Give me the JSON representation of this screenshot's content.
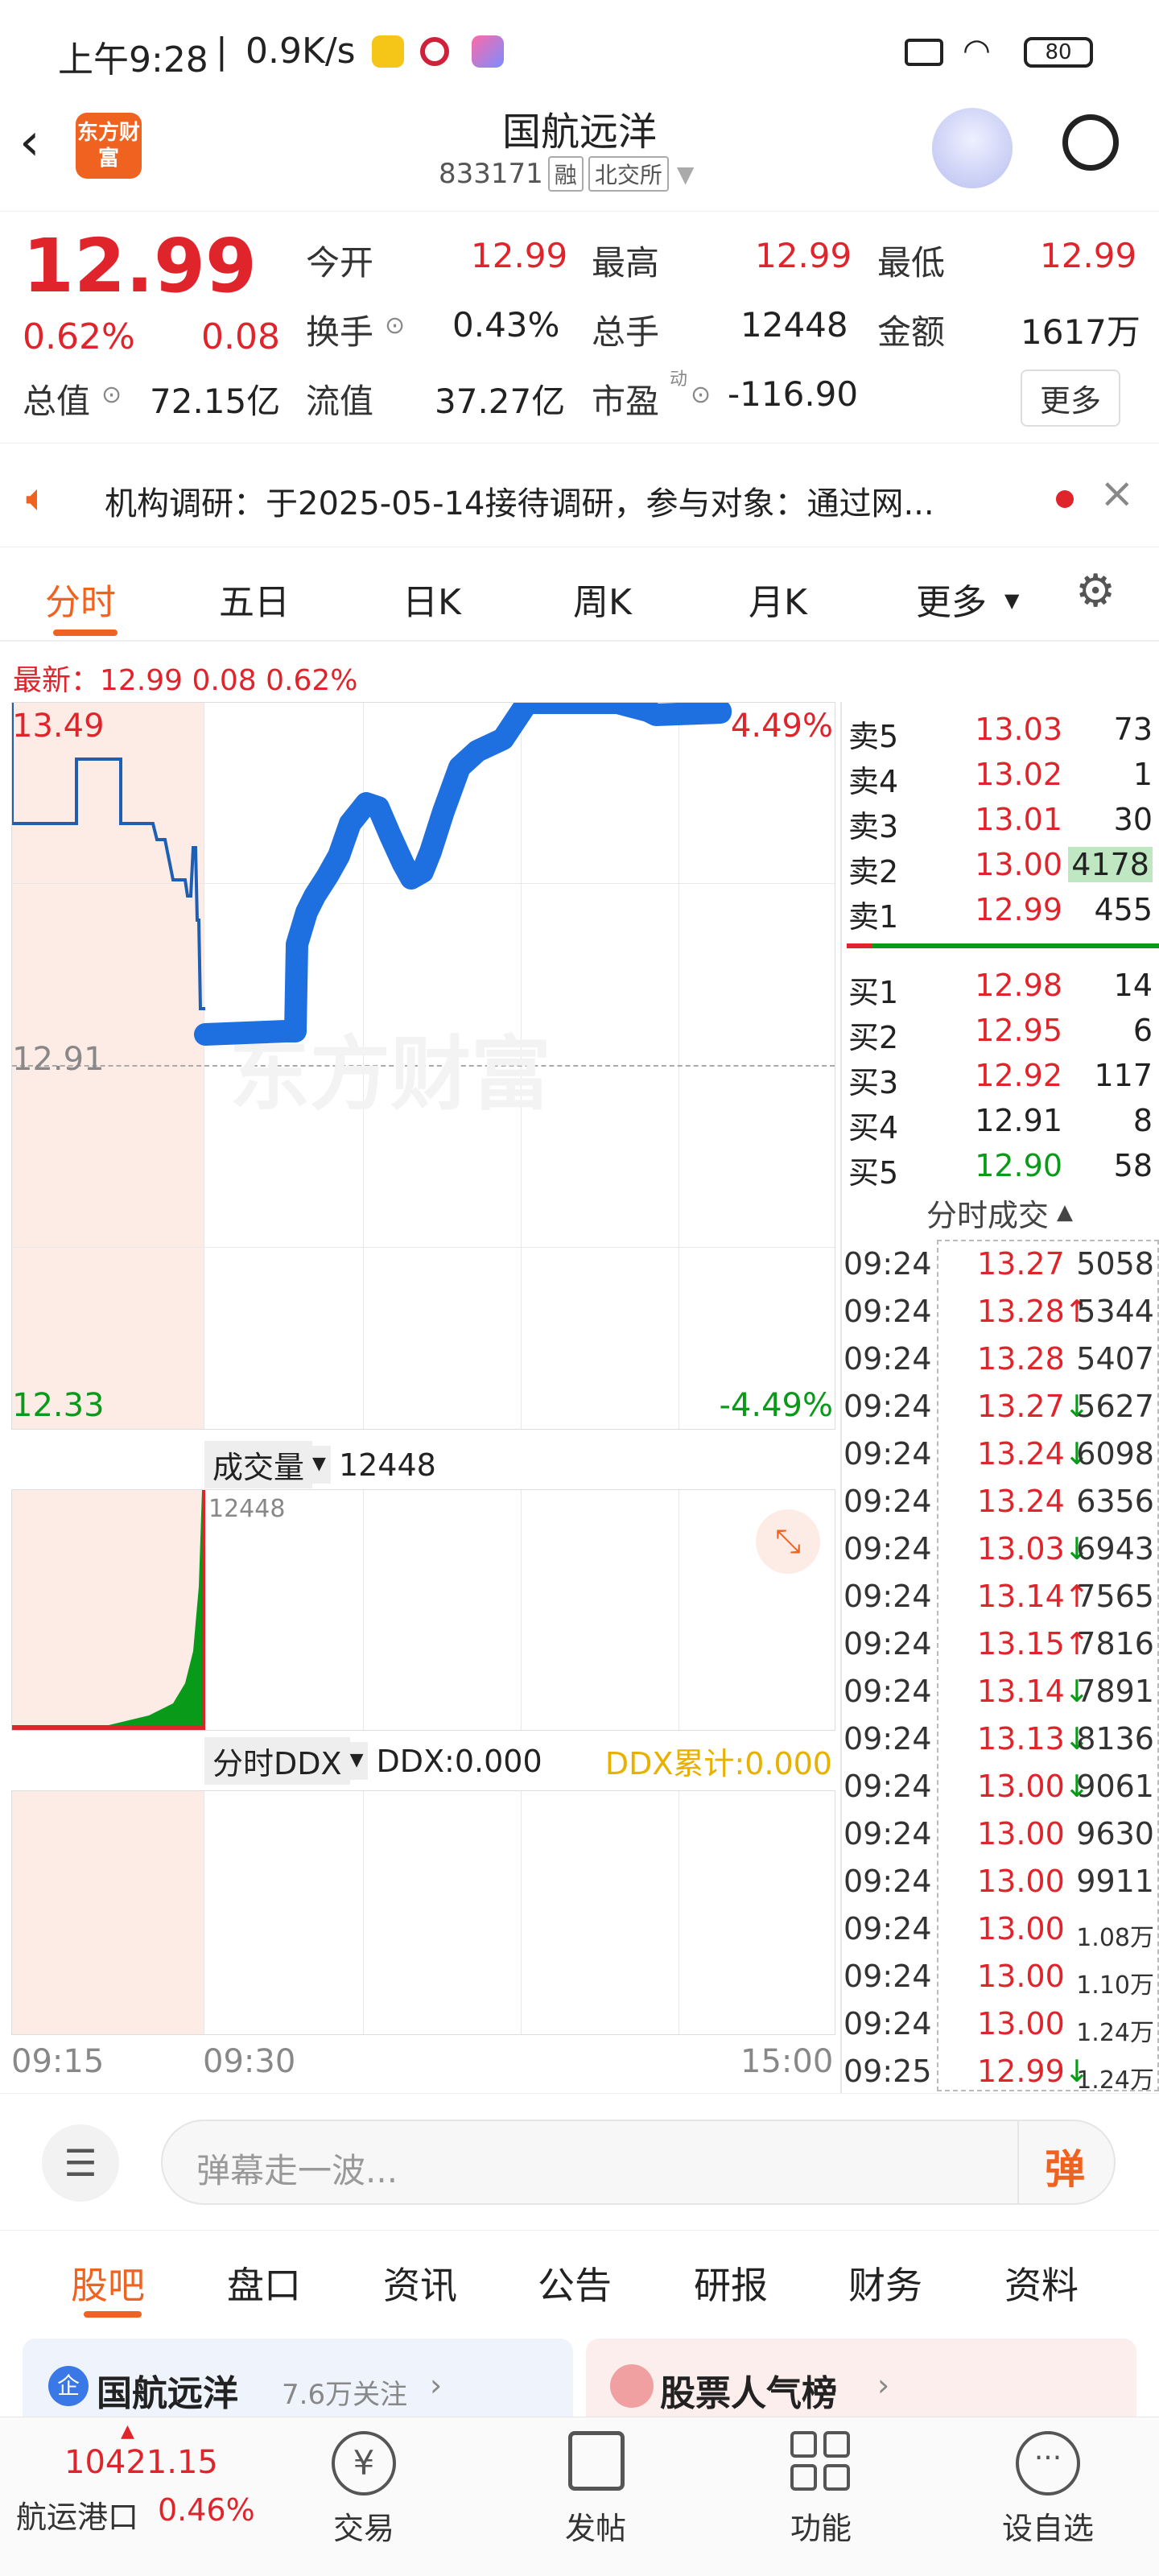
{
  "status": {
    "time": "上午9:28",
    "speed": "0.9K/s",
    "battery": "80"
  },
  "header": {
    "logo_text": "东方财富",
    "title": "国航远洋",
    "code": "833171",
    "tag1": "融",
    "tag2": "北交所"
  },
  "quote": {
    "price": "12.99",
    "change_pct": "0.62%",
    "change": "0.08",
    "labels": {
      "open": "今开",
      "high": "最高",
      "low": "最低",
      "turnover": "换手",
      "volume": "总手",
      "amount": "金额",
      "mktcap": "总值",
      "float": "流值",
      "pe": "市盈",
      "pe_sup": "动"
    },
    "values": {
      "open": "12.99",
      "high": "12.99",
      "low": "12.99",
      "turnover": "0.43%",
      "volume": "12448",
      "amount": "1617万",
      "mktcap": "72.15亿",
      "float": "37.27亿",
      "pe": "-116.90"
    },
    "more": "更多"
  },
  "notice": {
    "text": "机构调研：于2025-05-14接待调研，参与对象：通过网..."
  },
  "tabs": [
    "分时",
    "五日",
    "日K",
    "周K",
    "月K",
    "更多"
  ],
  "chart": {
    "latest": "最新：12.99  0.08  0.62%",
    "y_high": "13.49",
    "y_mid": "12.91",
    "y_low": "12.33",
    "pct_high": "4.49%",
    "pct_low": "-4.49%",
    "watermark": "东方财富",
    "vol_label": "成交量",
    "vol_value": "12448",
    "vol_axis": "12448",
    "ddx_label": "分时DDX",
    "ddx_value": "DDX:0.000",
    "ddx_cum": "DDX累计:0.000",
    "time_start": "09:15",
    "time_mid": "09:30",
    "time_end": "15:00"
  },
  "orderbook": {
    "sell": [
      {
        "label": "卖5",
        "price": "13.03",
        "vol": "73"
      },
      {
        "label": "卖4",
        "price": "13.02",
        "vol": "1"
      },
      {
        "label": "卖3",
        "price": "13.01",
        "vol": "30"
      },
      {
        "label": "卖2",
        "price": "13.00",
        "vol": "4178"
      },
      {
        "label": "卖1",
        "price": "12.99",
        "vol": "455"
      }
    ],
    "buy": [
      {
        "label": "买1",
        "price": "12.98",
        "vol": "14"
      },
      {
        "label": "买2",
        "price": "12.95",
        "vol": "6"
      },
      {
        "label": "买3",
        "price": "12.92",
        "vol": "117"
      },
      {
        "label": "买4",
        "price": "12.91",
        "vol": "8"
      },
      {
        "label": "买5",
        "price": "12.90",
        "vol": "58"
      }
    ]
  },
  "ticks_title": "分时成交",
  "ticks": [
    {
      "time": "09:24",
      "price": "13.27",
      "dir": "",
      "vol": "5058"
    },
    {
      "time": "09:24",
      "price": "13.28",
      "dir": "↑",
      "vol": "5344"
    },
    {
      "time": "09:24",
      "price": "13.28",
      "dir": "",
      "vol": "5407"
    },
    {
      "time": "09:24",
      "price": "13.27",
      "dir": "↓",
      "vol": "5627"
    },
    {
      "time": "09:24",
      "price": "13.24",
      "dir": "↓",
      "vol": "6098"
    },
    {
      "time": "09:24",
      "price": "13.24",
      "dir": "",
      "vol": "6356"
    },
    {
      "time": "09:24",
      "price": "13.03",
      "dir": "↓",
      "vol": "6943"
    },
    {
      "time": "09:24",
      "price": "13.14",
      "dir": "↑",
      "vol": "7565"
    },
    {
      "time": "09:24",
      "price": "13.15",
      "dir": "↑",
      "vol": "7816"
    },
    {
      "time": "09:24",
      "price": "13.14",
      "dir": "↓",
      "vol": "7891"
    },
    {
      "time": "09:24",
      "price": "13.13",
      "dir": "↓",
      "vol": "8136"
    },
    {
      "time": "09:24",
      "price": "13.00",
      "dir": "↓",
      "vol": "9061"
    },
    {
      "time": "09:24",
      "price": "13.00",
      "dir": "",
      "vol": "9630"
    },
    {
      "time": "09:24",
      "price": "13.00",
      "dir": "",
      "vol": "9911"
    },
    {
      "time": "09:24",
      "price": "13.00",
      "dir": "",
      "vol": "1.08万"
    },
    {
      "time": "09:24",
      "price": "13.00",
      "dir": "",
      "vol": "1.10万"
    },
    {
      "time": "09:24",
      "price": "13.00",
      "dir": "",
      "vol": "1.24万"
    },
    {
      "time": "09:25",
      "price": "12.99",
      "dir": "↓",
      "vol": "1.24万"
    }
  ],
  "comment": {
    "placeholder": "弹幕走一波...",
    "danmu": "弹"
  },
  "subtabs": [
    "股吧",
    "盘口",
    "资讯",
    "公告",
    "研报",
    "财务",
    "资料"
  ],
  "cards": {
    "left_title": "国航远洋",
    "left_sub": "7.6万关注",
    "left_badge": "企",
    "right_title": "股票人气榜"
  },
  "bottom": {
    "index_value": "10421.15",
    "index_name": "航运港口",
    "index_pct": "0.46%",
    "nav": [
      "交易",
      "发帖",
      "功能",
      "设自选"
    ]
  }
}
